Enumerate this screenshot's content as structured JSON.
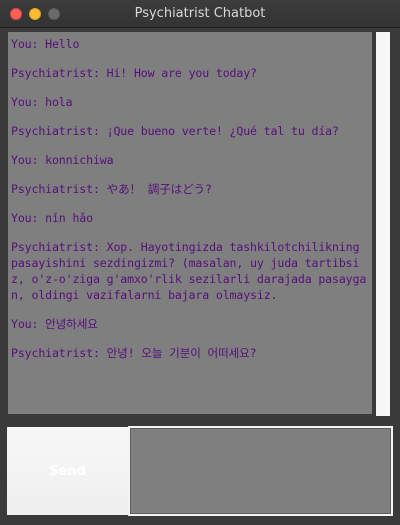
{
  "window": {
    "title": "Psychiatrist Chatbot"
  },
  "chat": {
    "messages": [
      "You: Hello",
      "Psychiatrist: Hi! How are you today?",
      "You: hola",
      "Psychiatrist: ¡Que bueno verte! ¿Qué tal tu día?",
      "You: konnichiwa",
      "Psychiatrist: やあ！ 調子はどう?",
      "You: nǐn hǎo",
      "Psychiatrist: Xop. Hayotingizda tashkilotchilikning pasayishini sezdingizmi? (masalan, uy juda tartibsiz, o'z-o'ziga g'amxo'rlik sezilarli darajada pasaygan, oldingi vazifalarni bajara olmaysiz.",
      "You: 안녕하세요",
      "Psychiatrist: 안녕! 오늘 기분이 어떠세요?"
    ]
  },
  "composer": {
    "send_label": "Send",
    "input_value": ""
  },
  "colors": {
    "message_text": "#56107a",
    "chat_background": "#7f7f7f",
    "window_background": "#3a3a3a"
  }
}
